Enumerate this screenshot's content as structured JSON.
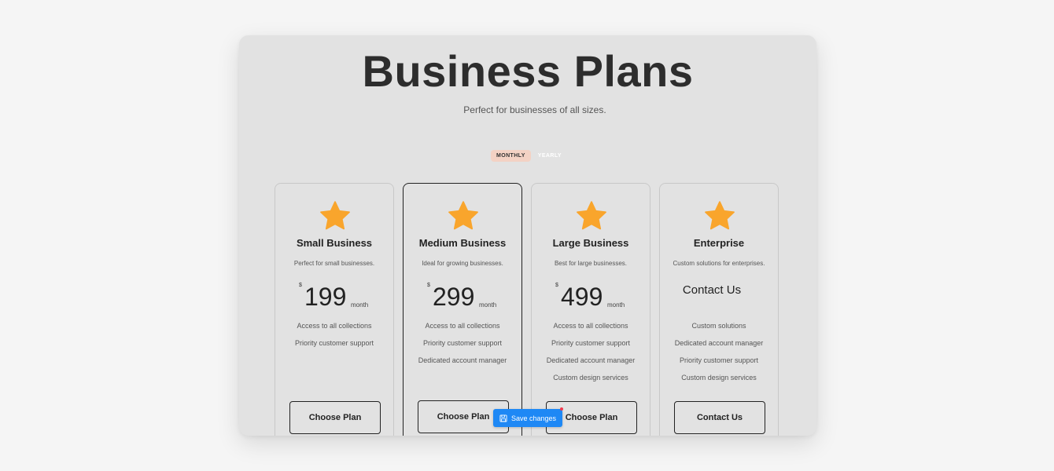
{
  "page": {
    "title": "Business Plans",
    "subtitle": "Perfect for businesses of all sizes."
  },
  "toggle": {
    "monthly": "MONTHLY",
    "yearly": "YEARLY",
    "selected": "MONTHLY"
  },
  "plans": [
    {
      "name": "Small Business",
      "description": "Perfect for small businesses.",
      "currency": "$",
      "price": "199",
      "period": "month",
      "features": [
        "Access to all collections",
        "Priority customer support"
      ],
      "button": "Choose Plan"
    },
    {
      "name": "Medium Business",
      "description": "Ideal for growing businesses.",
      "currency": "$",
      "price": "299",
      "period": "month",
      "features": [
        "Access to all collections",
        "Priority customer support",
        "Dedicated account manager"
      ],
      "button": "Choose Plan"
    },
    {
      "name": "Large Business",
      "description": "Best for large businesses.",
      "currency": "$",
      "price": "499",
      "period": "month",
      "features": [
        "Access to all collections",
        "Priority customer support",
        "Dedicated account manager",
        "Custom design services"
      ],
      "button": "Choose Plan"
    },
    {
      "name": "Enterprise",
      "description": "Custom solutions for enterprises.",
      "price_text": "Contact Us",
      "features": [
        "Custom solutions",
        "Dedicated account manager",
        "Priority customer support",
        "Custom design services"
      ],
      "button": "Contact Us"
    }
  ],
  "save_button": {
    "label": "Save changes"
  },
  "colors": {
    "star": "#F9A52C",
    "card_bg": "#E2E2E2",
    "toggle_active_bg": "#F3D2C4",
    "save_bg": "#1E88F5",
    "notify_dot": "#F0394D"
  },
  "icons": {
    "plan": "star-icon",
    "save": "save-icon"
  }
}
